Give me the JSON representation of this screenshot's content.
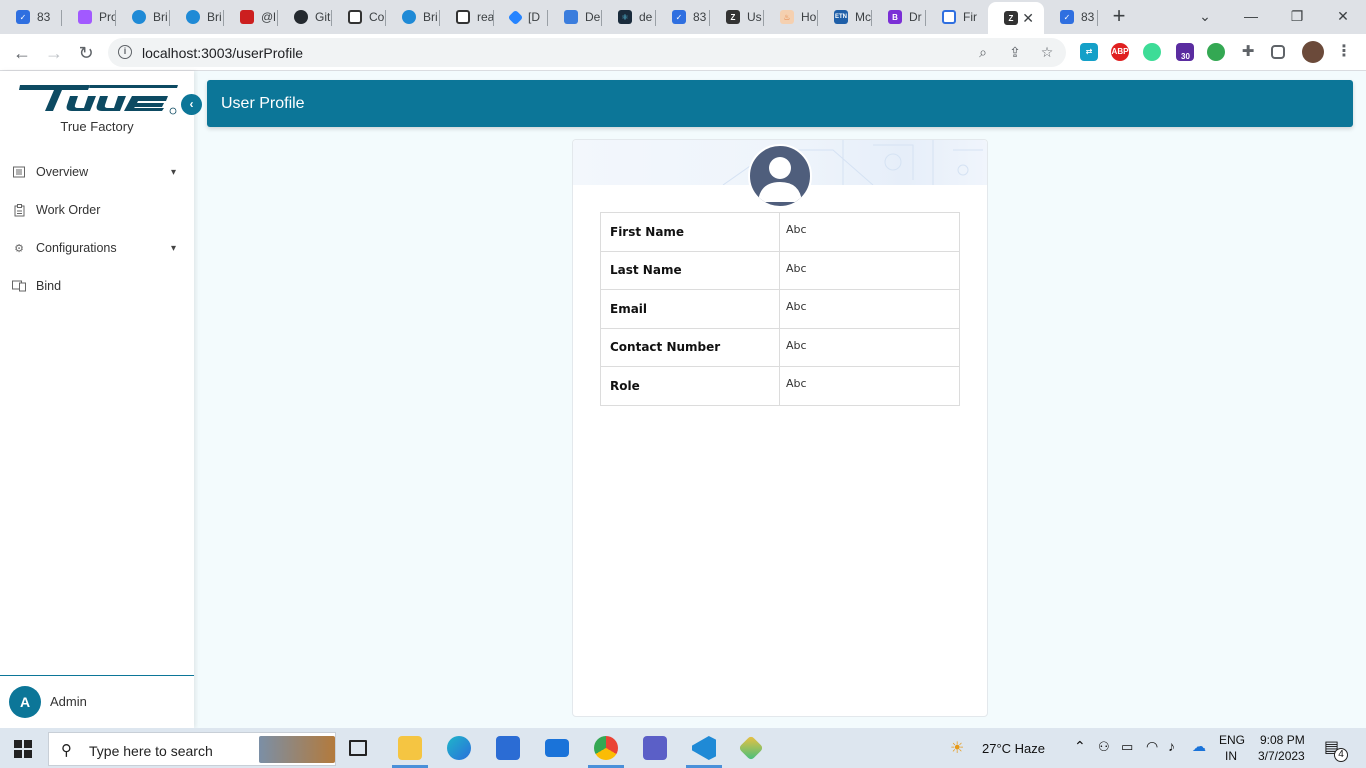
{
  "browser": {
    "tabs": [
      {
        "title": "83",
        "color": "#2f6fe0"
      },
      {
        "title": "Pro",
        "color": "#a259ff"
      },
      {
        "title": "Bri",
        "color": "#1f8ad6"
      },
      {
        "title": "Bri",
        "color": "#1f8ad6"
      },
      {
        "title": "@l",
        "color": "#cc1f1f"
      },
      {
        "title": "Git",
        "color": "#24292f"
      },
      {
        "title": "Co",
        "color": "#333333"
      },
      {
        "title": "Bri",
        "color": "#1f8ad6"
      },
      {
        "title": "rea",
        "color": "#333333"
      },
      {
        "title": "[D",
        "color": "#2684ff"
      },
      {
        "title": "De",
        "color": "#3b7ddd"
      },
      {
        "title": "de",
        "color": "#1a2b3c"
      },
      {
        "title": "83",
        "color": "#2f6fe0"
      },
      {
        "title": "Us",
        "color": "#333333"
      },
      {
        "title": "Ho",
        "color": "#e0702b"
      },
      {
        "title": "Mc",
        "color": "#1f5fa8"
      },
      {
        "title": "Dr",
        "color": "#7b2fd6"
      },
      {
        "title": "Fir",
        "color": "#2f6fe0"
      },
      {
        "title": "",
        "color": "#333333"
      },
      {
        "title": "83",
        "color": "#2f6fe0"
      }
    ],
    "url": "localhost:3003/userProfile",
    "extension_badge": "30"
  },
  "sidebar": {
    "brand": "True",
    "brand_subtitle": "True Factory",
    "items": [
      {
        "label": "Overview",
        "icon": "list-icon",
        "has_submenu": true
      },
      {
        "label": "Work Order",
        "icon": "clipboard-icon",
        "has_submenu": false
      },
      {
        "label": "Configurations",
        "icon": "gear-icon",
        "has_submenu": true
      },
      {
        "label": "Bind",
        "icon": "bind-icon",
        "has_submenu": false
      }
    ],
    "user": {
      "initial": "A",
      "name": "Admin"
    }
  },
  "header": {
    "title": "User Profile"
  },
  "profile": {
    "rows": [
      {
        "label": "First Name",
        "value": "Abc"
      },
      {
        "label": "Last Name",
        "value": "Abc"
      },
      {
        "label": "Email",
        "value": "Abc"
      },
      {
        "label": "Contact Number",
        "value": "Abc"
      },
      {
        "label": "Role",
        "value": "Abc"
      }
    ]
  },
  "taskbar": {
    "search_placeholder": "Type here to search",
    "weather": "27°C  Haze",
    "language": "ENG",
    "region": "IN",
    "time": "9:08 PM",
    "date": "3/7/2023",
    "notifications": "4"
  },
  "colors": {
    "primary": "#0c7698",
    "content_bg": "#f3fbfd"
  }
}
